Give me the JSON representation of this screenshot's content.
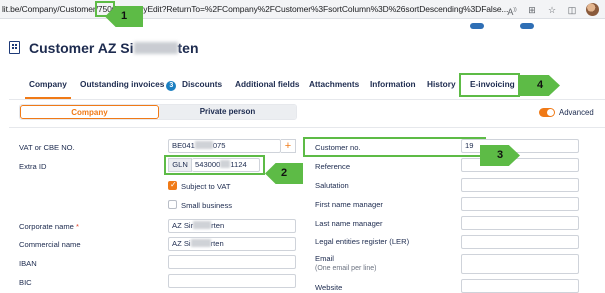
{
  "browser": {
    "url_prefix": "lit.be/Company/Customer/",
    "url_id": "750",
    "url_suffix": "CompanyEdit?ReturnTo=%2FCompany%2FCustomer%3FsortColumn%3D%26sortDescending%3DFalse..."
  },
  "header": {
    "title_start": "Customer AZ Si",
    "title_end": "ten"
  },
  "tabs": [
    {
      "label": "Company",
      "active": true
    },
    {
      "label": "Outstanding invoices",
      "badge": "3"
    },
    {
      "label": "Discounts"
    },
    {
      "label": "Additional fields"
    },
    {
      "label": "Attachments"
    },
    {
      "label": "Information"
    },
    {
      "label": "History"
    },
    {
      "label": "E-invoicing"
    }
  ],
  "segment": {
    "company": "Company",
    "private_person": "Private person"
  },
  "advanced": {
    "label": "Advanced",
    "on": true
  },
  "left_form": {
    "vat_label": "VAT or CBE NO.",
    "vat_value_start": "BE041",
    "vat_value_end": "075",
    "vat_plus": "+",
    "extra_id_label": "Extra ID",
    "gln_prefix": "GLN",
    "gln_value_start": "543000",
    "gln_value_end": "1124",
    "subject_to_vat": "Subject to VAT",
    "small_business": "Small business",
    "corporate_name_label": "Corporate name",
    "required_mark": "*",
    "corporate_name_start": "AZ Sir",
    "corporate_name_end": "rten",
    "commercial_name_label": "Commercial name",
    "commercial_name_start": "AZ Si",
    "commercial_name_end": "rten",
    "iban_label": "IBAN",
    "bic_label": "BIC"
  },
  "right_form": {
    "customer_no_label": "Customer no.",
    "customer_no_value": "19",
    "reference_label": "Reference",
    "salutation_label": "Salutation",
    "first_name_manager_label": "First name manager",
    "last_name_manager_label": "Last name manager",
    "legal_entities_label": "Legal entities register (LER)",
    "email_label": "Email",
    "email_hint": "(One email per line)",
    "website_label": "Website"
  },
  "callouts": [
    "1",
    "2",
    "3",
    "4"
  ],
  "colors": {
    "accent": "#f07a17",
    "highlight_green": "#5dbb46",
    "navy_text": "#1d2b4f",
    "badge_blue": "#1b7fc1"
  },
  "icons": [
    "building-icon",
    "read-aloud-icon",
    "reader-mode-icon",
    "favorite-star-icon",
    "split-screen-icon",
    "profile-avatar"
  ]
}
